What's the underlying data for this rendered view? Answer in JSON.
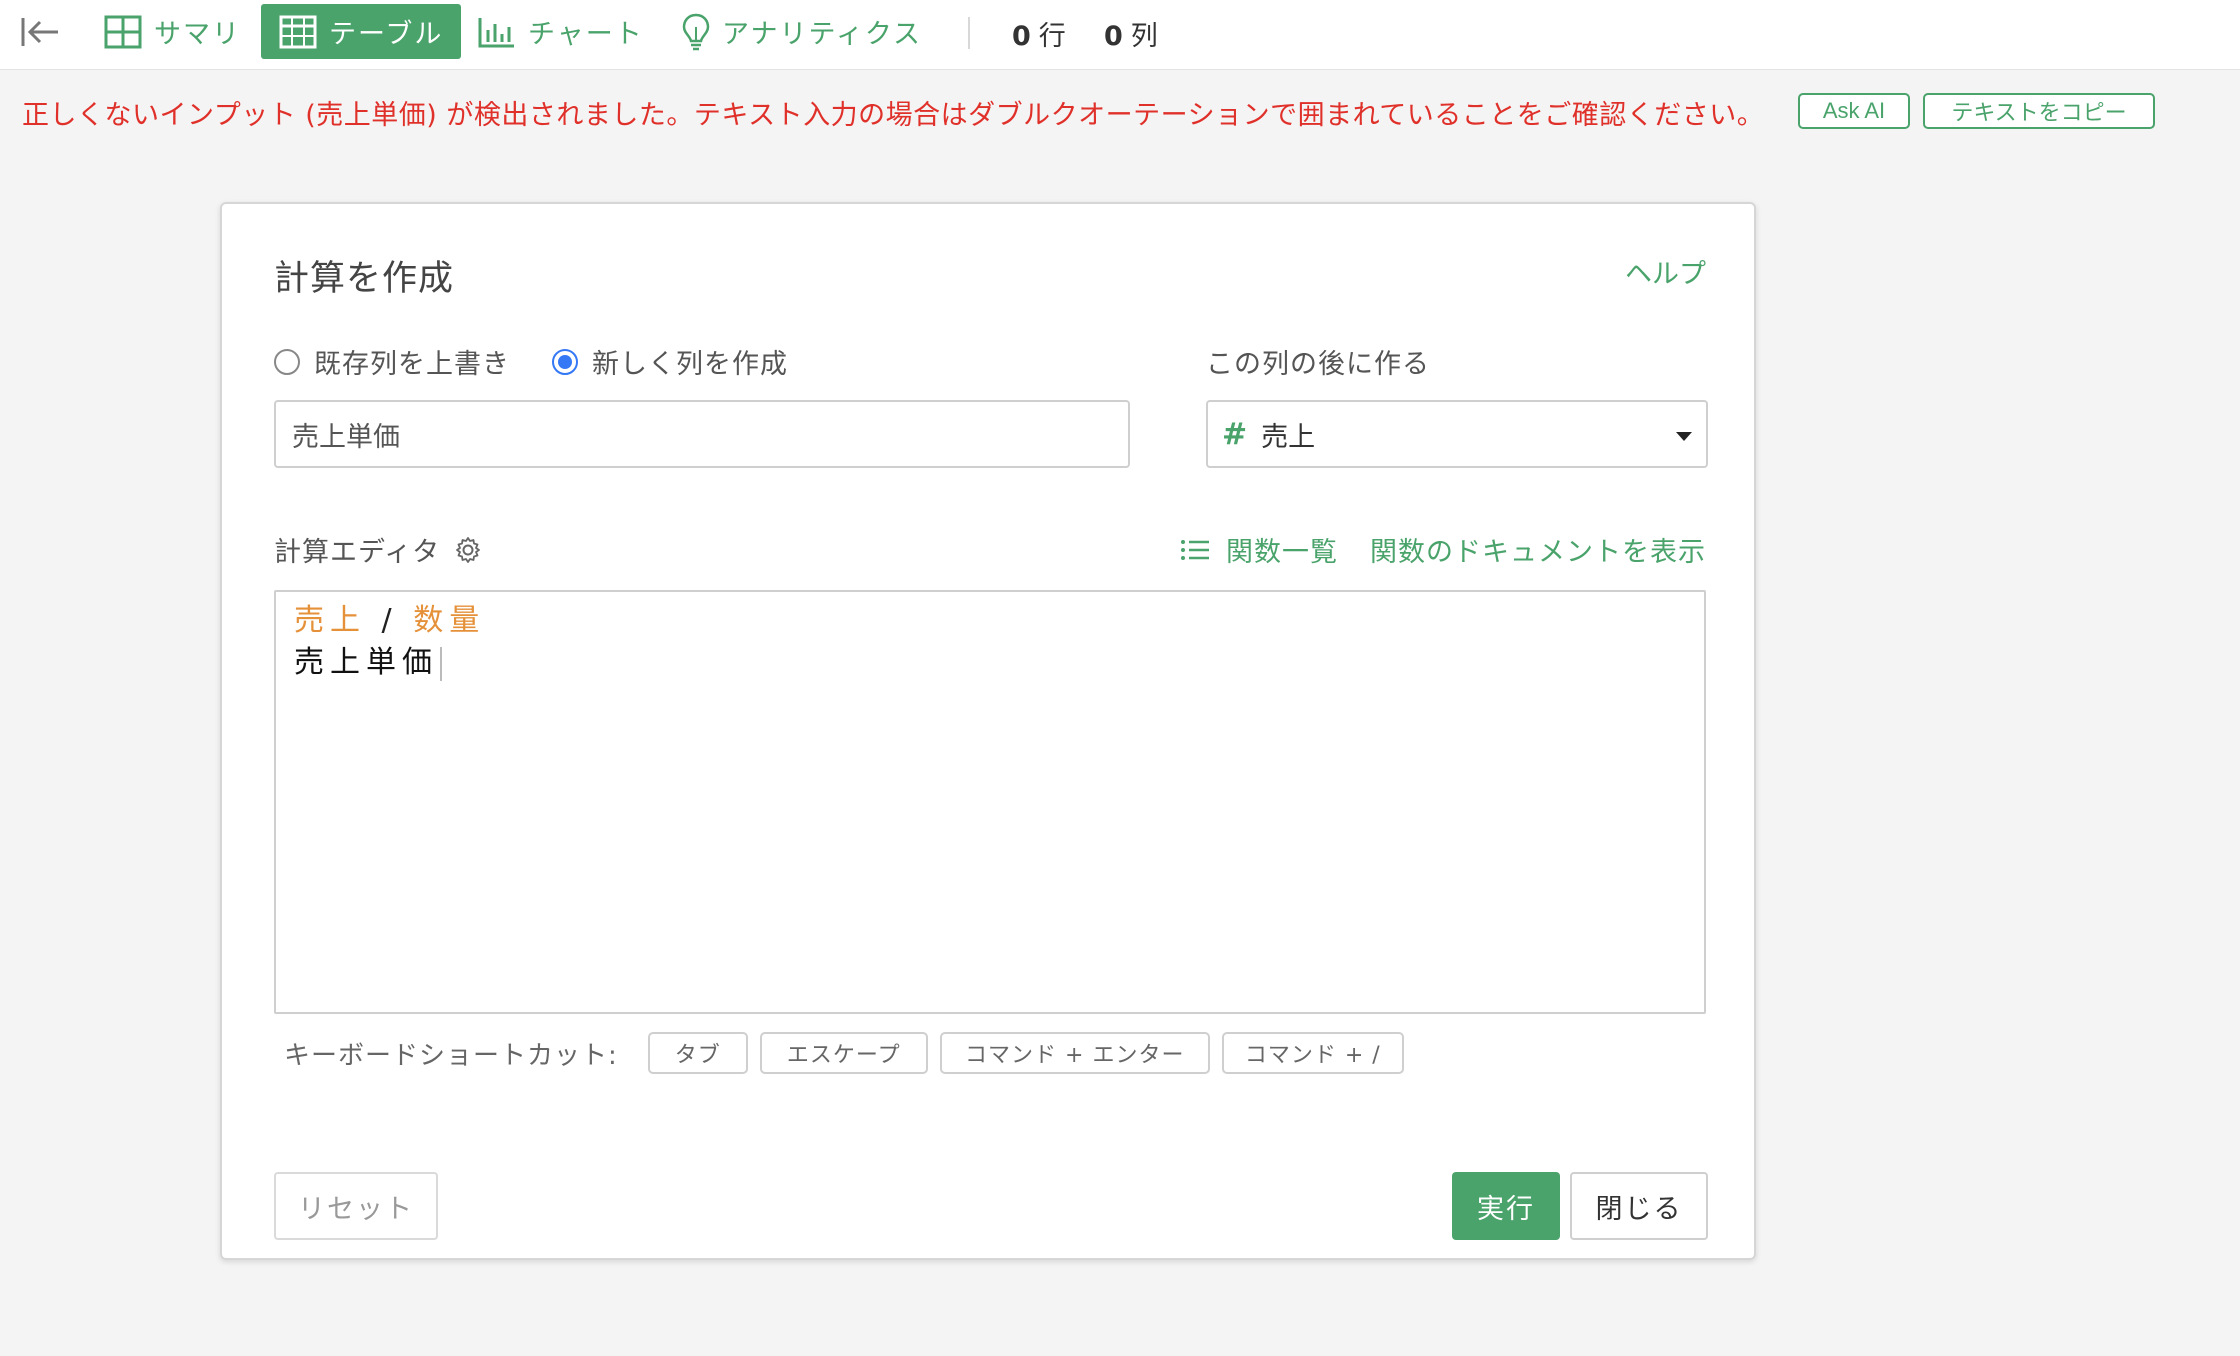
{
  "toolbar": {
    "tabs": [
      {
        "label": "サマリ",
        "icon": "summary-grid-icon"
      },
      {
        "label": "テーブル",
        "icon": "table-icon"
      },
      {
        "label": "チャート",
        "icon": "chart-icon"
      },
      {
        "label": "アナリティクス",
        "icon": "lightbulb-icon"
      }
    ],
    "rows_count": "0",
    "rows_unit": "行",
    "cols_count": "0",
    "cols_unit": "列"
  },
  "error": {
    "message": "正しくないインプット (売上単価) が検出されました。テキスト入力の場合はダブルクオーテーションで囲まれていることをご確認ください。",
    "ask_ai_label": "Ask AI",
    "copy_label": "テキストをコピー"
  },
  "dialog": {
    "title": "計算を作成",
    "help_label": "ヘルプ",
    "radio_overwrite": "既存列を上書き",
    "radio_new": "新しく列を作成",
    "after_label": "この列の後に作る",
    "column_name_value": "売上単価",
    "after_column_value": "売上",
    "editor_label": "計算エディタ",
    "func_list_label": "関数一覧",
    "func_docs_label": "関数のドキュメントを表示",
    "editor_lines": {
      "l1_ref1": "売上",
      "l1_op": "/",
      "l1_ref2": "数量",
      "l2_text": "売上単価"
    },
    "shortcuts_label": "キーボードショートカット:",
    "shortcuts": [
      "タブ",
      "エスケープ",
      "コマンド + エンター",
      "コマンド + /"
    ],
    "reset_label": "リセット",
    "run_label": "実行",
    "close_label": "閉じる"
  },
  "colors": {
    "accent_green": "#4aa36b",
    "error_red": "#e0302a",
    "column_ref_orange": "#e5913a",
    "radio_blue": "#3478f6"
  }
}
